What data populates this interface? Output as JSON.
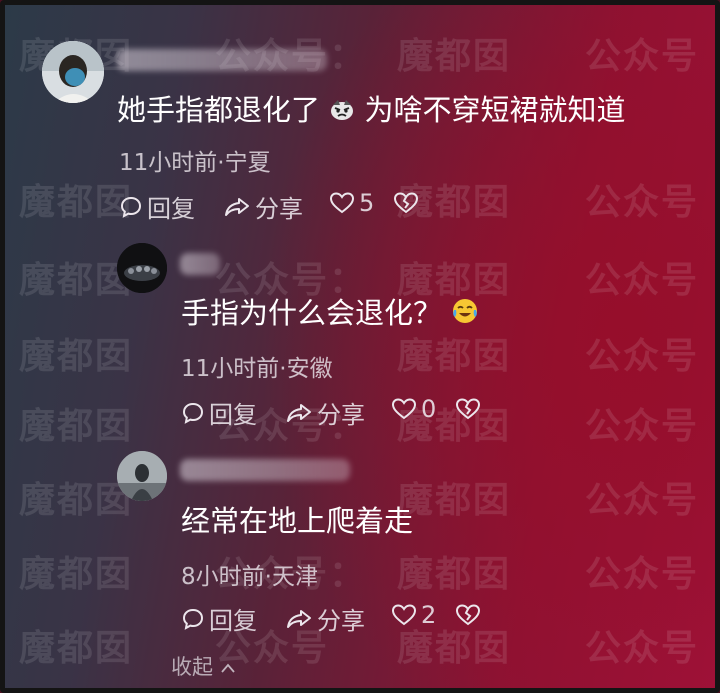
{
  "watermark": {
    "text_a": "魔都囡",
    "text_b": "公众号",
    "sep": "："
  },
  "comments": [
    {
      "content_before_emoji": "她手指都退化了",
      "content_after_emoji": "为啥不穿短裙就知道",
      "emoji_icon": "angry-face-icon",
      "meta": "11小时前·宁夏",
      "reply_label": "回复",
      "share_label": "分享",
      "like_count": "5"
    },
    {
      "content": "手指为什么会退化？",
      "emoji_icon": "tears-of-joy-emoji",
      "meta": "11小时前·安徽",
      "reply_label": "回复",
      "share_label": "分享",
      "like_count": "0"
    },
    {
      "content": "经常在地上爬着走",
      "meta": "8小时前·天津",
      "reply_label": "回复",
      "share_label": "分享",
      "like_count": "2"
    }
  ],
  "collapse_label": "收起",
  "colors": {
    "background_red": "#9e1238",
    "background_slate": "#2c3a48",
    "text": "#ffffff"
  }
}
